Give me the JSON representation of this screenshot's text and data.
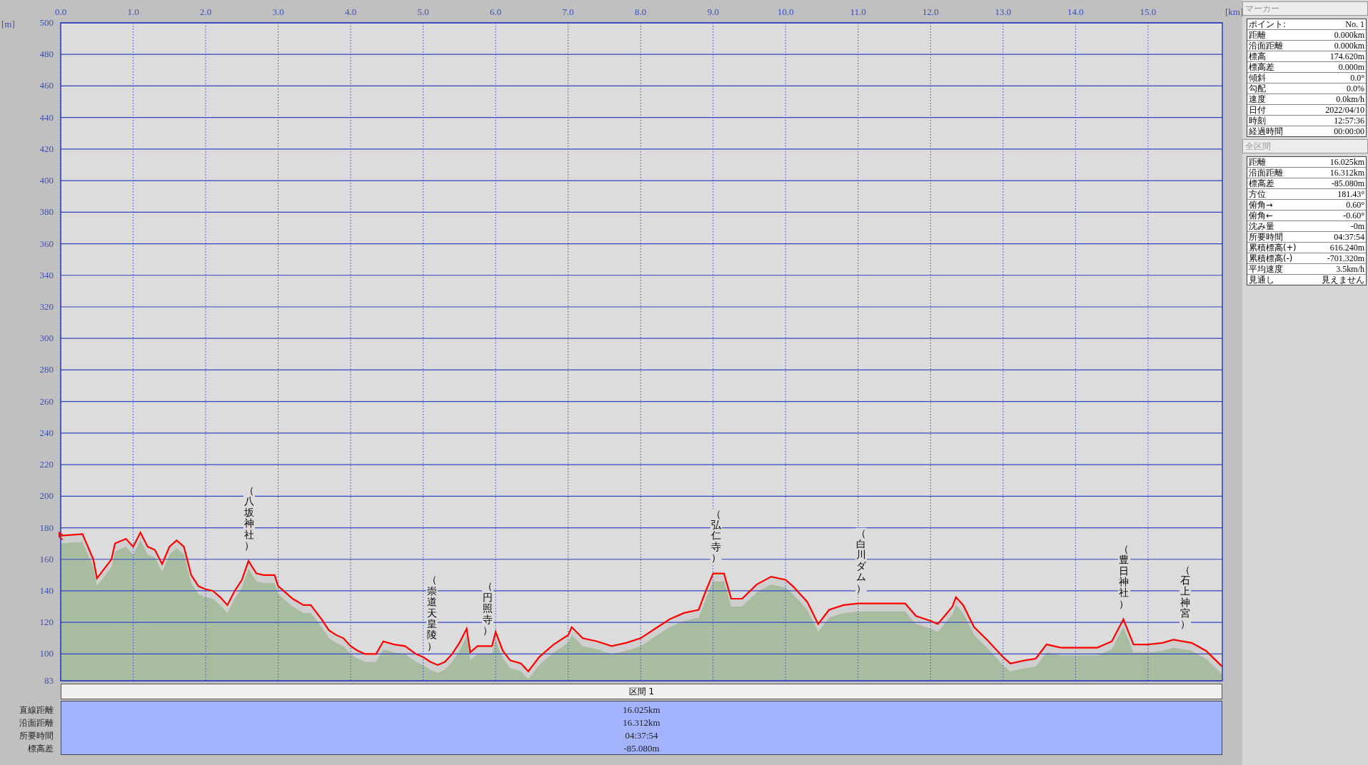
{
  "profile": {
    "chart_data": {
      "type": "line",
      "grid": true,
      "xlabel": "[km]",
      "ylabel": "[m]",
      "xlim": [
        0,
        16.025
      ],
      "ylim": [
        83,
        500
      ],
      "xticks": [
        {
          "value": 0,
          "label": "0.0"
        },
        {
          "value": 1,
          "label": "1.0"
        },
        {
          "value": 2,
          "label": "2.0"
        },
        {
          "value": 3,
          "label": "3.0"
        },
        {
          "value": 4,
          "label": "4.0"
        },
        {
          "value": 5,
          "label": "5.0"
        },
        {
          "value": 6,
          "label": "6.0"
        },
        {
          "value": 7,
          "label": "7.0"
        },
        {
          "value": 8,
          "label": "8.0"
        },
        {
          "value": 9,
          "label": "9.0"
        },
        {
          "value": 10,
          "label": "10.0"
        },
        {
          "value": 11,
          "label": "11.0"
        },
        {
          "value": 12,
          "label": "12.0"
        },
        {
          "value": 13,
          "label": "13.0"
        },
        {
          "value": 14,
          "label": "14.0"
        },
        {
          "value": 15,
          "label": "15.0"
        }
      ],
      "yticks": [
        83,
        100,
        120,
        140,
        160,
        180,
        200,
        220,
        240,
        260,
        280,
        300,
        320,
        340,
        360,
        380,
        400,
        420,
        440,
        460,
        480,
        500
      ],
      "x": [
        0,
        0.3,
        0.45,
        0.5,
        0.7,
        0.75,
        0.9,
        1.0,
        1.1,
        1.2,
        1.3,
        1.4,
        1.5,
        1.6,
        1.7,
        1.8,
        1.9,
        2.0,
        2.1,
        2.2,
        2.3,
        2.4,
        2.5,
        2.59,
        2.7,
        2.8,
        2.95,
        3.0,
        3.1,
        3.2,
        3.35,
        3.45,
        3.6,
        3.7,
        3.8,
        3.9,
        4.0,
        4.1,
        4.2,
        4.35,
        4.45,
        4.6,
        4.75,
        4.9,
        5.0,
        5.1,
        5.2,
        5.3,
        5.4,
        5.5,
        5.6,
        5.65,
        5.75,
        5.95,
        6.0,
        6.1,
        6.2,
        6.35,
        6.45,
        6.6,
        6.8,
        7.0,
        7.05,
        7.2,
        7.4,
        7.6,
        7.8,
        8.0,
        8.2,
        8.4,
        8.6,
        8.8,
        8.9,
        9.0,
        9.15,
        9.25,
        9.4,
        9.6,
        9.8,
        10.0,
        10.1,
        10.3,
        10.45,
        10.6,
        10.8,
        11.0,
        11.5,
        11.65,
        11.8,
        12.0,
        12.1,
        12.3,
        12.35,
        12.45,
        12.6,
        12.8,
        13.0,
        13.1,
        13.3,
        13.45,
        13.6,
        13.8,
        14.0,
        14.3,
        14.5,
        14.66,
        14.8,
        15.0,
        15.2,
        15.35,
        15.6,
        15.8,
        16.0,
        16.025
      ],
      "series": [
        {
          "color": "#ff0000",
          "values": [
            175,
            176,
            160,
            148,
            160,
            170,
            173,
            168,
            177,
            168,
            166,
            157,
            168,
            172,
            168,
            150,
            143,
            141,
            140,
            136,
            131,
            140,
            147,
            159,
            151,
            150,
            150,
            143,
            139,
            135,
            131,
            131,
            122,
            115,
            112,
            110,
            105,
            102,
            100,
            100,
            108,
            106,
            105,
            100,
            98,
            95,
            93,
            95,
            100,
            107,
            116,
            101,
            105,
            105,
            114,
            102,
            96,
            94,
            89,
            98,
            106,
            112,
            117,
            110,
            108,
            105,
            107,
            110,
            116,
            122,
            126,
            128,
            140,
            151,
            151,
            135,
            135,
            144,
            149,
            147,
            143,
            133,
            119,
            128,
            131,
            132,
            132,
            132,
            124,
            121,
            119,
            130,
            136,
            131,
            117,
            108,
            98,
            94,
            96,
            97,
            106,
            104,
            104,
            104,
            108,
            122,
            106,
            106,
            107,
            109,
            107,
            102,
            93,
            92
          ]
        }
      ],
      "annotations": [
        "（八坂神社）",
        "（崇道天皇陵）",
        "（円照寺）",
        "（弘仁寺）",
        "（白川ダム）",
        "（豊日神社）",
        "（石上神宮）"
      ]
    }
  },
  "section_table": {
    "header": "区間 1",
    "rows": [
      {
        "label": "直線距離",
        "value": "16.025km"
      },
      {
        "label": "沿面距離",
        "value": "16.312km"
      },
      {
        "label": "所要時間",
        "value": "04:37:54"
      },
      {
        "label": "標高差",
        "value": "-85.080m"
      }
    ]
  },
  "marker_panel": {
    "title": "マーカー",
    "rows": [
      {
        "label": "ポイント:",
        "value": "No. 1"
      },
      {
        "label": "距離",
        "value": "0.000km"
      },
      {
        "label": "沿面距離",
        "value": "0.000km"
      },
      {
        "label": "標高",
        "value": "174.620m"
      },
      {
        "label": "標高差",
        "value": "0.000m"
      },
      {
        "label": "傾斜",
        "value": "0.0°"
      },
      {
        "label": "勾配",
        "value": "0.0%"
      },
      {
        "label": "速度",
        "value": "0.0km/h"
      },
      {
        "label": "日付",
        "value": "2022/04/10"
      },
      {
        "label": "時刻",
        "value": "12:57:36"
      },
      {
        "label": "経過時間",
        "value": "00:00:00"
      }
    ]
  },
  "total_panel": {
    "title": "全区間",
    "rows": [
      {
        "label": "距離",
        "value": "16.025km"
      },
      {
        "label": "沿面距離",
        "value": "16.312km"
      },
      {
        "label": "標高差",
        "value": "-85.080m"
      },
      {
        "label": "方位",
        "value": "181.43°"
      },
      {
        "label": "俯角→",
        "value": "0.60°"
      },
      {
        "label": "俯角←",
        "value": "-0.60°"
      },
      {
        "label": "沈み量",
        "value": "-0m"
      },
      {
        "label": "所要時間",
        "value": "04:37:54"
      },
      {
        "label": "累積標高(+)",
        "value": "616.240m"
      },
      {
        "label": "累積標高(-)",
        "value": "-701.320m"
      },
      {
        "label": "平均速度",
        "value": "3.5km/h"
      },
      {
        "label": "見通し",
        "value": "見えません"
      }
    ]
  }
}
